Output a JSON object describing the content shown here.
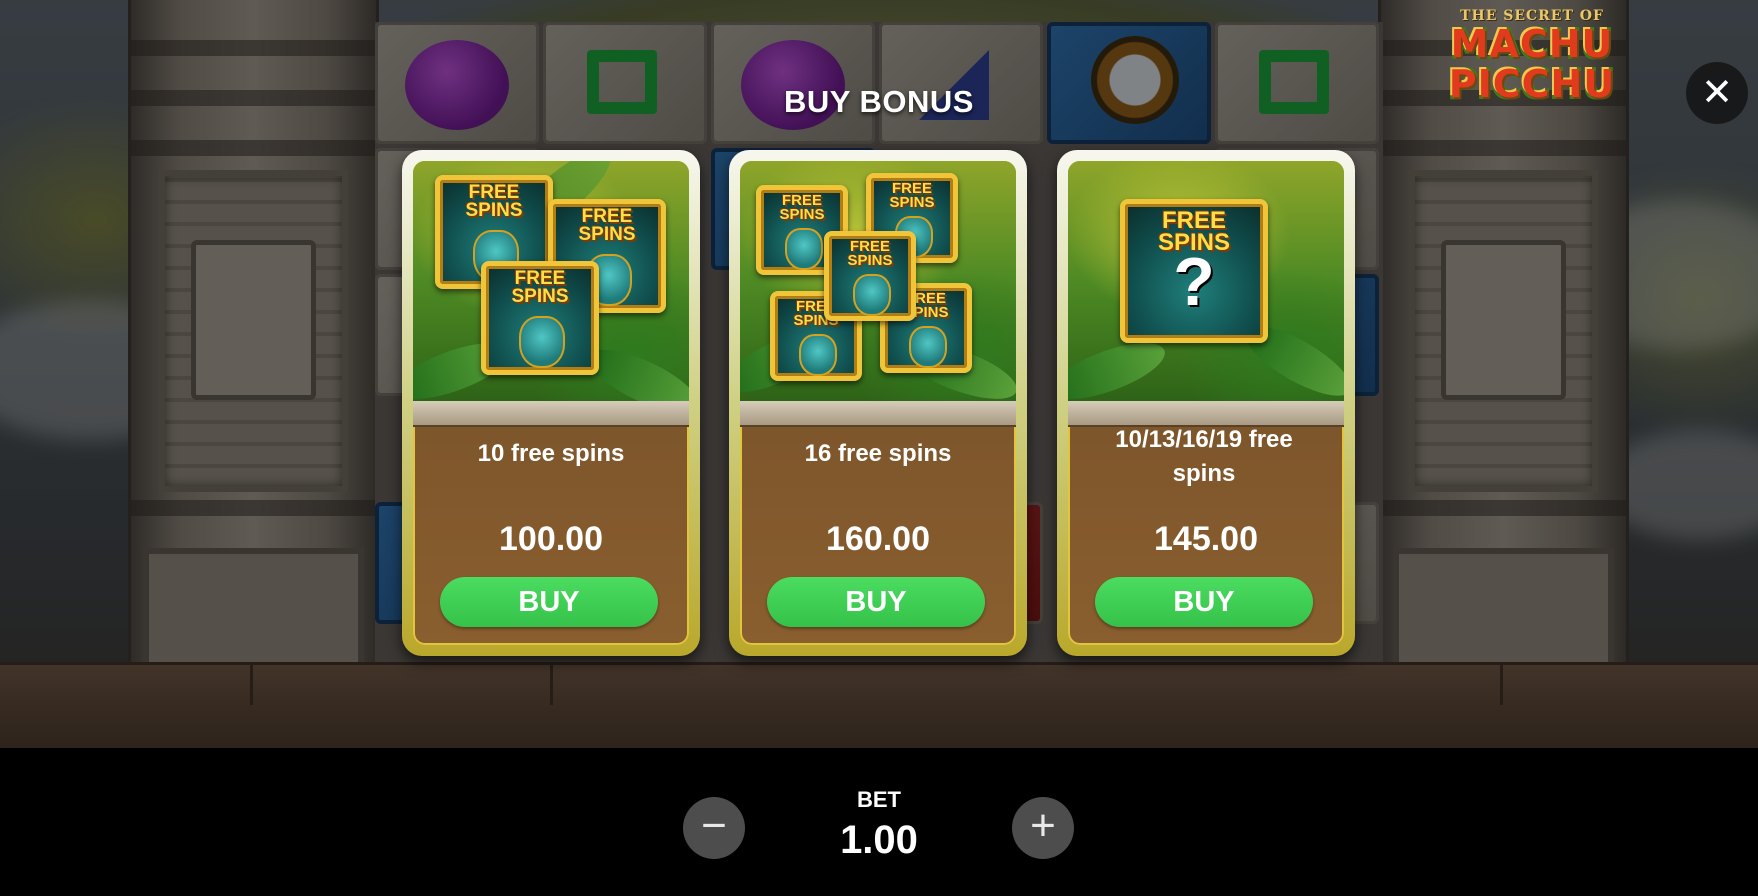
{
  "logo": {
    "line1": "THE SECRET OF",
    "line2": "MACHU",
    "line3": "PICCHU"
  },
  "close_icon": "close-icon",
  "buy_bonus": {
    "title": "BUY BONUS",
    "symbol_text": "FREE\nSPINS",
    "options": [
      {
        "label": "10 free spins",
        "price": "100.00",
        "button": "BUY",
        "symbol_count": 3
      },
      {
        "label": "16 free spins",
        "price": "160.00",
        "button": "BUY",
        "symbol_count": 5
      },
      {
        "label": "10/13/16/19 free spins",
        "price": "145.00",
        "button": "BUY",
        "symbol_count": 1,
        "mystery": "?"
      }
    ]
  },
  "bet": {
    "label": "BET",
    "value": "1.00",
    "decrease_icon": "minus-icon",
    "increase_icon": "plus-icon"
  },
  "colors": {
    "buy_button": "#3fcf55",
    "card_border": "#e3c43d",
    "card_body": "#7a532a",
    "bottom_bar": "#000000"
  }
}
